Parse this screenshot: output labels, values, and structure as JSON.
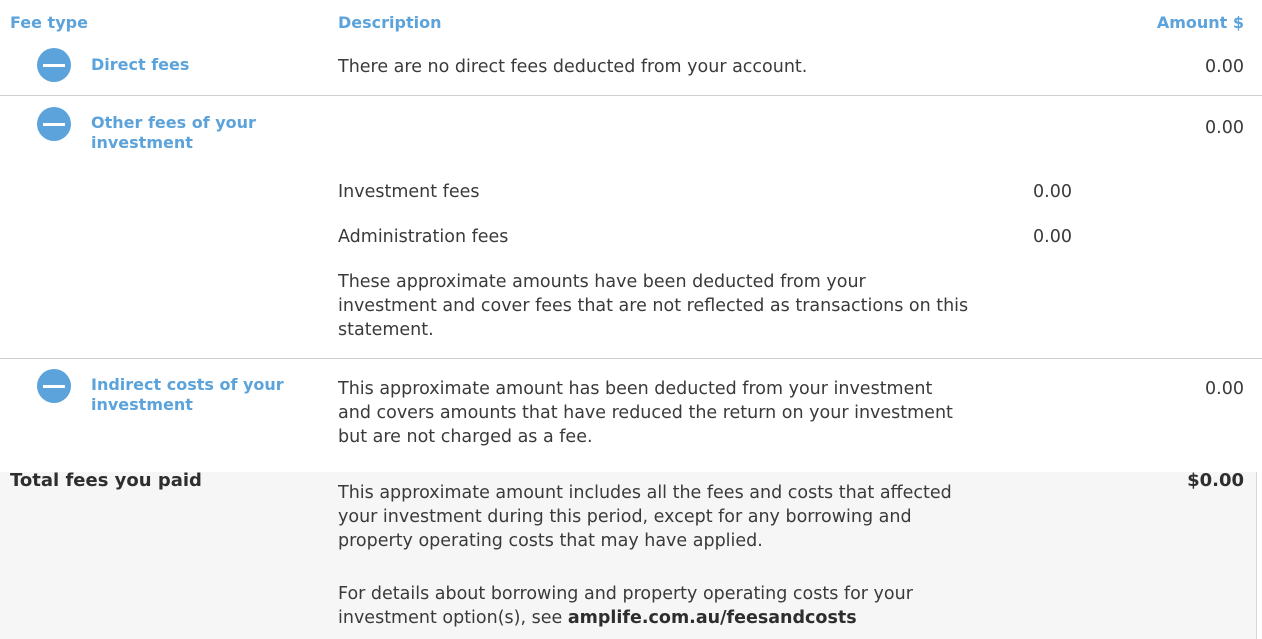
{
  "header": {
    "fee_type": "Fee type",
    "description": "Description",
    "amount": "Amount $"
  },
  "direct_fees": {
    "label": "Direct fees",
    "description": "There are no direct fees deducted from your account.",
    "amount": "0.00"
  },
  "other_fees": {
    "label_line1": "Other fees of your",
    "label_line2": "investment",
    "amount": "0.00",
    "items": [
      {
        "label": "Investment fees",
        "amount": "0.00"
      },
      {
        "label": "Administration fees",
        "amount": "0.00"
      }
    ],
    "note_line1": "These approximate amounts have been deducted from your",
    "note_line2": "investment and cover fees that are not reflected as transactions on this",
    "note_line3": "statement."
  },
  "indirect_costs": {
    "label_line1": "Indirect costs of your",
    "label_line2": "investment",
    "desc_line1": "This approximate amount has been deducted from your investment",
    "desc_line2": "and covers amounts that have reduced the return on your investment",
    "desc_line3": "but are not charged as a fee.",
    "amount": "0.00"
  },
  "total": {
    "label": "Total fees you paid",
    "amount": "$0.00",
    "desc_line1": "This approximate amount includes all the fees and costs that affected",
    "desc_line2": "your investment during this period, except for any borrowing and",
    "desc_line3": "property operating costs that may have applied.",
    "details_line1": "For details about borrowing and property operating costs for your",
    "details_line2_prefix": "investment option(s), see ",
    "details_link": "amplife.com.au/feesandcosts"
  },
  "colors": {
    "accent": "#5ba3da",
    "text": "#3a3a3a",
    "total_bg": "#f6f6f6"
  },
  "icons": {
    "row_icon": "minus-circle-icon"
  }
}
